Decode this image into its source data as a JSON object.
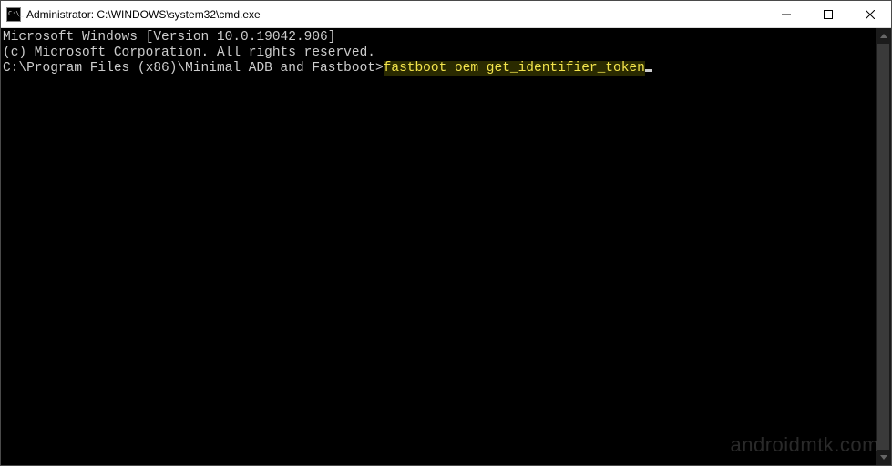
{
  "window": {
    "title": "Administrator: C:\\WINDOWS\\system32\\cmd.exe"
  },
  "terminal": {
    "line1": "Microsoft Windows [Version 10.0.19042.906]",
    "line2": "(c) Microsoft Corporation. All rights reserved.",
    "blank": "",
    "prompt": "C:\\Program Files (x86)\\Minimal ADB and Fastboot>",
    "command": "fastboot oem get_identifier_token"
  },
  "watermark": "androidmtk.com"
}
